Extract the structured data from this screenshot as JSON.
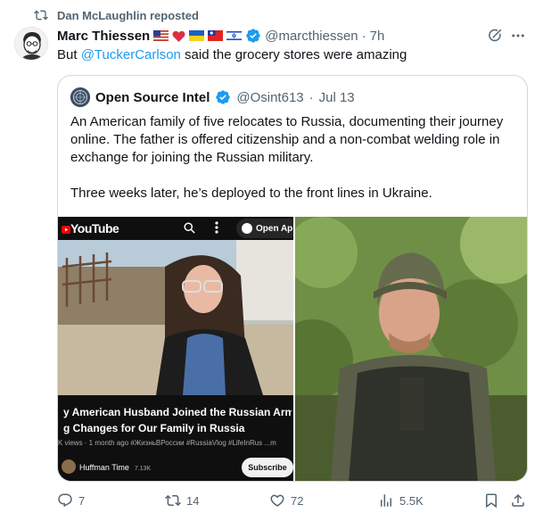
{
  "repost": {
    "label": "Dan McLaughlin reposted"
  },
  "post": {
    "author_name": "Marc Thiessen",
    "flags": [
      "us-flag",
      "red-heart",
      "ukraine-flag",
      "taiwan-flag",
      "israel-flag"
    ],
    "verified_icon": "verified-badge-icon",
    "handle": "@marcthiessen",
    "separator": "·",
    "time": "7h",
    "text_prefix": "But ",
    "mention": "@TuckerCarlson",
    "text_suffix": " said the grocery stores were amazing"
  },
  "quote": {
    "author_name": "Open Source Intel",
    "verified_icon": "verified-badge-icon",
    "handle": "@Osint613",
    "separator": "·",
    "date": "Jul 13",
    "paragraph_1": "An American family of five relocates to Russia, documenting their journey online. The father is offered citizenship and a non-combat welding role in exchange for joining the Russian military.",
    "paragraph_2": "Three weeks later, he’s deployed to the front lines in Ukraine."
  },
  "media_left": {
    "app_logo": "YouTube",
    "open_button": "Open Ap",
    "title_line_1": "y American Husband Joined the Russian Army",
    "title_line_2": "g Changes for Our Family in Russia",
    "meta": "K views · 1 month ago  #ЖизньВРоссии #RussiaVlog #LifeInRus ...m",
    "channel": "Huffman Time",
    "subscribers": "7.13K",
    "subscribe_label": "Subscribe"
  },
  "actions": {
    "replies": "7",
    "reposts": "14",
    "likes": "72",
    "views": "5.5K"
  },
  "colors": {
    "accent": "#1d9bf0",
    "secondary_text": "#536471",
    "border": "#cfd9de",
    "verified": "#1d9bf0"
  }
}
